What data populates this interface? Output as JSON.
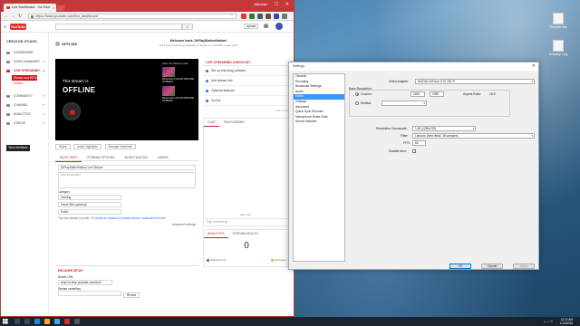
{
  "browser": {
    "tab_title": "Live Dashboard - YouTube",
    "url": "https://www.youtube.com/live_dashboard",
    "window_user": "Nicholas",
    "window_controls": "–  ☐  ✕"
  },
  "youtube": {
    "logo": "YouTube",
    "upload_label": "Upload"
  },
  "sidebar": {
    "title": "CREATOR STUDIO",
    "items": [
      {
        "label": "DASHBOARD"
      },
      {
        "label": "VIDEO MANAGER"
      },
      {
        "label": "LIVE STREAMING"
      }
    ],
    "sub_items": [
      "Stream now BETA",
      "Events"
    ],
    "items_lower": [
      {
        "label": "COMMUNITY"
      },
      {
        "label": "CHANNEL"
      },
      {
        "label": "ANALYTICS"
      },
      {
        "label": "CREATE"
      }
    ],
    "feedback": "Send feedback"
  },
  "main": {
    "status": "OFFLINE",
    "welcome_title": "Welcome back, DrPlayStationNation!",
    "welcome_sub": "You'll need streaming software to stream on YouTube. Learn more",
    "player_line1": "This stream is",
    "player_line2": "OFFLINE",
    "suggest_title": "After the stream ends",
    "suggest_cards": [
      "Minecraft 2 HOUR PRIVATE STREAM",
      "Minecraft 2 HOUR PRIVATE STREAM"
    ],
    "actions": [
      "Share",
      "Insert highlights",
      "Manage thumbnail"
    ],
    "tabs": [
      "BASIC INFO",
      "STREAM OPTIONS",
      "MONETIZATION",
      "CARDS"
    ],
    "title_value": "DrPlayStationNation Live Stream",
    "desc_placeholder": "Add description",
    "category_label": "Category",
    "category_value": "Gaming",
    "game_value": "Game title (optional)",
    "privacy_value": "Public",
    "privacy_hint": "This live stream is public.",
    "privacy_link": "To create an unlisted or private stream, schedule an event.",
    "advanced": "Advanced settings",
    "encoder_header": "ENCODER SETUP",
    "server_label": "Server URL",
    "server_value": "rtmp://a.rtmp.youtube.com/live2",
    "key_label": "Stream name/key",
    "reveal": "Reveal"
  },
  "right_panel": {
    "checklist_title": "LIVE STREAMING CHECKLIST",
    "checklist": [
      "Set up encoding software",
      "Add stream info",
      "Optional features",
      "Go live"
    ],
    "more": "Learn more",
    "chat_tabs": [
      "CHAT",
      "FAN FUNDING"
    ],
    "chat_placeholder": "Say something...",
    "chat_chip": "Hide chat",
    "analytics_tabs": [
      "ANALYTICS",
      "STREAM HEALTH"
    ],
    "viewers": "0",
    "legend": [
      "Watching now",
      "Messages"
    ],
    "colors": {
      "watching": "#2e7d32",
      "messages": "#f9a825"
    }
  },
  "dialog": {
    "title": "Settings",
    "categories": [
      "General",
      "Encoding",
      "Broadcast Settings",
      "Audio",
      "Video",
      "Hotkeys",
      "Advanced",
      "Quick Sync Encoder",
      "Microphone Noise Gate",
      "Scene Switcher"
    ],
    "selected_category": "Video",
    "video_adapter_label": "Video Adapter:",
    "video_adapter_value": "NVIDIA GeForce GTX 780 Ti",
    "base_res_label": "Base Resolution:",
    "custom_label": "Custom:",
    "width": "1920",
    "height": "1080",
    "aspect_label": "Aspect Ratio:",
    "aspect_value": "16:9",
    "monitor_label": "Monitor:",
    "downscale_label": "Resolution Downscale:",
    "downscale_value": "1.50 (1280x720)",
    "filter_label": "Filter:",
    "filter_value": "Lanczos (best detail, 36 samples)",
    "fps_label": "FPS:",
    "fps_value": "60",
    "aero_label": "Disable Aero:",
    "ok": "OK",
    "cancel": "Cancel",
    "apply": "Apply"
  },
  "desktop": {
    "icons": [
      "Recycle Bin",
      "Desktop Log"
    ]
  },
  "taskbar": {
    "time": "12:22 AM",
    "date": "1/14/2016"
  }
}
